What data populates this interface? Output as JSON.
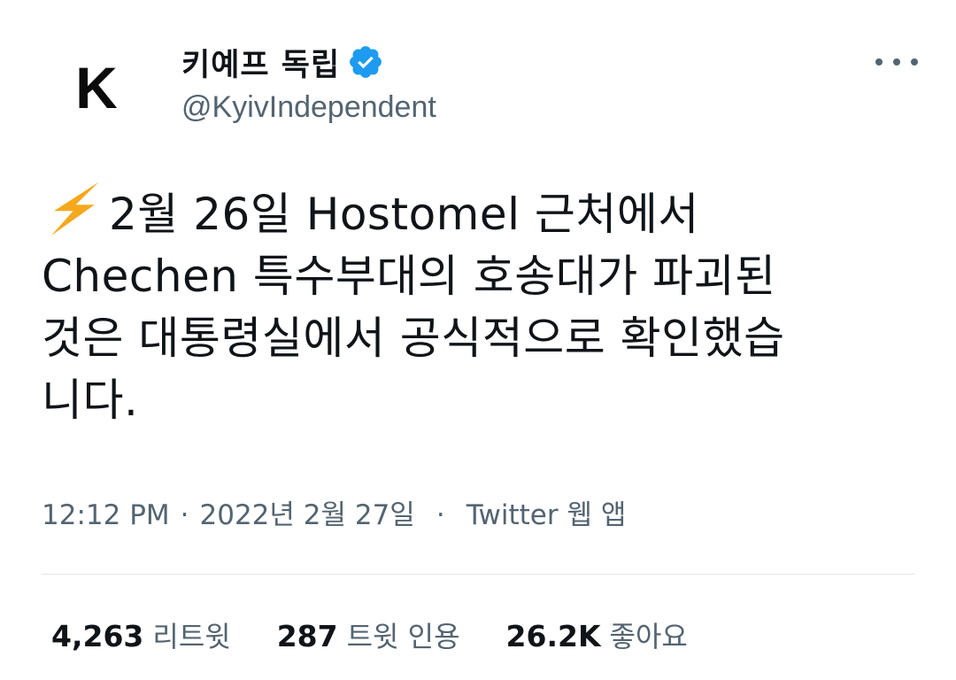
{
  "author": {
    "avatar_letter": "K",
    "display_name": "키예프 독립",
    "handle": "@KyivIndependent",
    "verified_icon": "verified-badge-icon"
  },
  "more_icon": "more-horizontal-icon",
  "tweet": {
    "emoji_icon": "high-voltage-emoji-icon",
    "lines": [
      "2월 26일 Hostomel 근처에서",
      "Chechen 특수부대의 호송대가 파괴된",
      "것은 대통령실에서 공식적으로 확인했습",
      "니다."
    ]
  },
  "meta": {
    "time": "12:12 PM",
    "date": "2022년 2월 27일",
    "source": "Twitter 웹 앱",
    "separator": "·"
  },
  "stats": [
    {
      "count": "4,263",
      "label": "리트윗"
    },
    {
      "count": "287",
      "label": "트윗 인용"
    },
    {
      "count": "26.2K",
      "label": "좋아요"
    }
  ],
  "colors": {
    "text": "#0f1419",
    "secondary": "#536471",
    "verified": "#1d9bf0",
    "bolt": "#f4a81d",
    "divider": "#e1e8ed"
  }
}
